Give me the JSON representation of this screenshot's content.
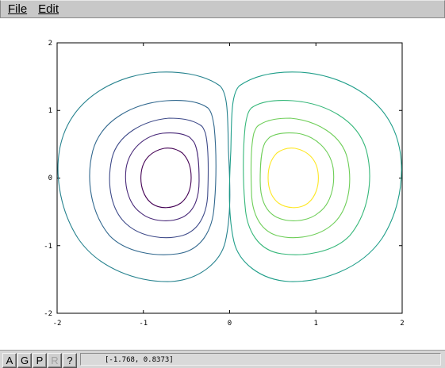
{
  "menubar": {
    "file_label": "File",
    "edit_label": "Edit"
  },
  "plot": {
    "xticks": [
      "-2",
      "-1",
      "0",
      "1",
      "2"
    ],
    "yticks": [
      "2",
      "1",
      "0",
      "-1",
      "-2"
    ],
    "xlim": [
      -2,
      2
    ],
    "ylim": [
      -2,
      2
    ],
    "contour_colors": {
      "dark_purple": "#440154",
      "purple": "#482878",
      "indigo": "#3e4a89",
      "blue": "#31688e",
      "teal": "#26828e",
      "teal_green": "#1f9e89",
      "green": "#35b779",
      "light_green": "#6ece58",
      "yellow": "#fde725"
    }
  },
  "toolbar": {
    "buttons": [
      "A",
      "G",
      "P",
      "R",
      "?"
    ],
    "coordinates": "[-1.768, 0.8373]"
  }
}
